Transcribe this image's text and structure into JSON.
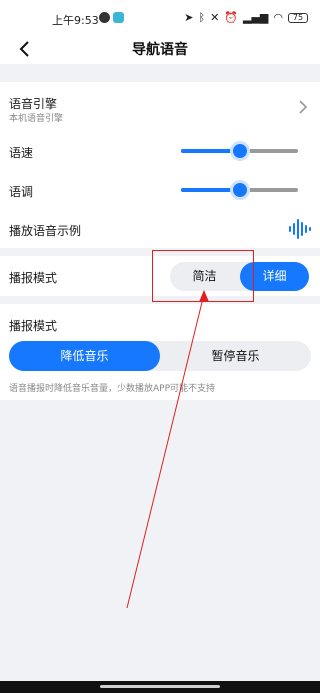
{
  "status_bar": {
    "time": "上午9:53",
    "battery": "75"
  },
  "nav": {
    "title": "导航语音"
  },
  "engine": {
    "label": "语音引擎",
    "sub": "本机语音引擎"
  },
  "speed": {
    "label": "语速",
    "value_pct": 50
  },
  "tone": {
    "label": "语调",
    "value_pct": 50
  },
  "sample": {
    "label": "播放语音示例"
  },
  "broadcast_mode": {
    "label": "播报模式",
    "options": [
      "简洁",
      "详细"
    ],
    "selected": "详细"
  },
  "music_mode": {
    "label": "播报模式",
    "options": [
      "降低音乐",
      "暂停音乐"
    ],
    "selected": "降低音乐",
    "note": "语音播报时降低音乐音量，少数播放APP可能不支持"
  },
  "colors": {
    "accent": "#1677ff",
    "background": "#f1f2f6",
    "annotation": "#e02020"
  }
}
